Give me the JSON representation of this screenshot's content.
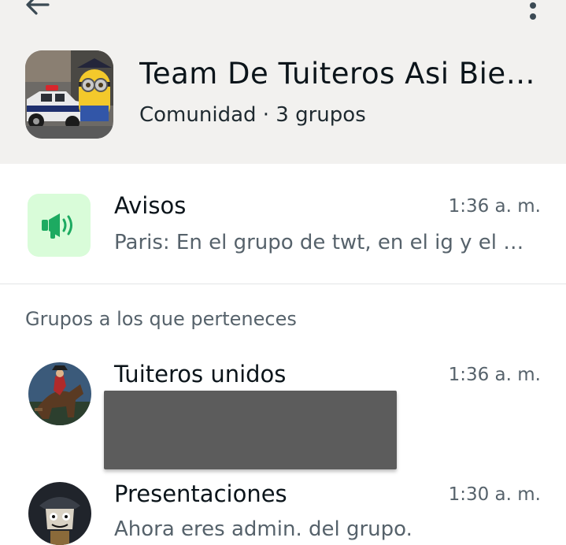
{
  "community": {
    "name": "Team De Tuiteros Asi Bie…",
    "meta": "Comunidad · 3 grupos"
  },
  "announcements": {
    "title": "Avisos",
    "time": "1:36 a. m.",
    "preview": "Paris: En el grupo de twt, en el ig y el g…"
  },
  "section": {
    "label": "Grupos a los que perteneces"
  },
  "groups": [
    {
      "title": "Tuiteros unidos",
      "time": "1:36 a. m.",
      "preview": ""
    },
    {
      "title": "Presentaciones",
      "time": "1:30 a. m.",
      "preview": "Ahora eres admin. del grupo."
    }
  ],
  "colors": {
    "header_bg": "#f2f1ef",
    "announcement_icon_bg": "#d9fcd9",
    "announcement_icon_fg": "#1daa61",
    "secondary_text": "#56626b"
  },
  "icons": {
    "back": "arrow-left-icon",
    "more": "vertical-dots-icon",
    "announcement": "megaphone-icon"
  }
}
